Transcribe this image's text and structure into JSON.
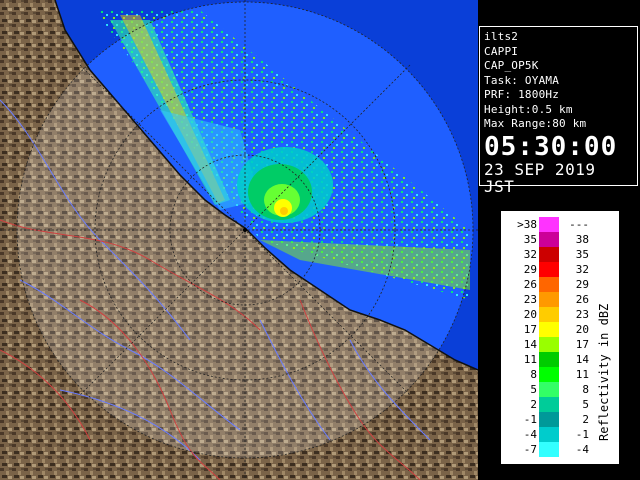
{
  "radar": {
    "sea_color": "#1f5fff",
    "outer_sea_color": "#0a3fd8",
    "land_color": "#8a7050"
  },
  "info": {
    "lines": [
      "ilts2",
      "CAPPI",
      "CAP_OP5K",
      "Task: OYAMA",
      "PRF: 1800Hz",
      "Height:0.5 km",
      "Max Range:80 km"
    ],
    "time": "05:30:00",
    "date": "23 SEP 2019 JST"
  },
  "legend": {
    "title": "Reflectivity in dBZ",
    "rows": [
      {
        "lo": ">38",
        "hi": "---",
        "color": "#ff33ff"
      },
      {
        "lo": "35",
        "hi": "38",
        "color": "#cc0099"
      },
      {
        "lo": "32",
        "hi": "35",
        "color": "#cc0000"
      },
      {
        "lo": "29",
        "hi": "32",
        "color": "#ff0000"
      },
      {
        "lo": "26",
        "hi": "29",
        "color": "#ff6600"
      },
      {
        "lo": "23",
        "hi": "26",
        "color": "#ff9900"
      },
      {
        "lo": "20",
        "hi": "23",
        "color": "#ffcc00"
      },
      {
        "lo": "17",
        "hi": "20",
        "color": "#ffff00"
      },
      {
        "lo": "14",
        "hi": "17",
        "color": "#99ff00"
      },
      {
        "lo": "11",
        "hi": "14",
        "color": "#00cc00"
      },
      {
        "lo": "8",
        "hi": "11",
        "color": "#00ff00"
      },
      {
        "lo": "5",
        "hi": "8",
        "color": "#33ff66"
      },
      {
        "lo": "2",
        "hi": "5",
        "color": "#00cc99"
      },
      {
        "lo": "-1",
        "hi": "2",
        "color": "#009999"
      },
      {
        "lo": "-4",
        "hi": "-1",
        "color": "#00cccc"
      },
      {
        "lo": "-7",
        "hi": "-4",
        "color": "#33ffff"
      }
    ]
  }
}
